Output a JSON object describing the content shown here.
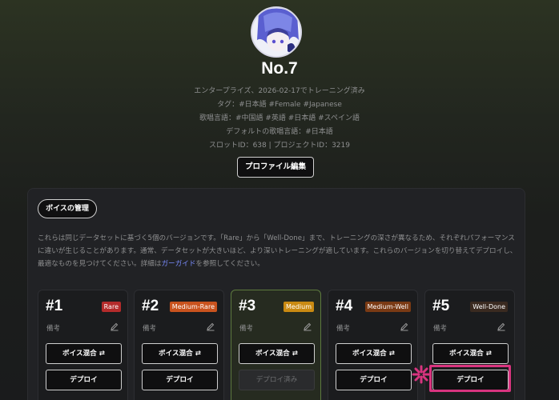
{
  "profile": {
    "name": "No.7",
    "trained_line": "エンタープライズ、2026-02-17でトレーニング済み",
    "tags_line": "タグ：#日本語 #Female #Japanese",
    "singing_langs_line": "歌唱言語：#中国語 #英語 #日本語 #スペイン語",
    "default_lang_line": "デフォルトの歌唱言語：#日本語",
    "ids_line": "スロットID：638 | プロジェクトID：3219",
    "edit_button": "プロファイル編集"
  },
  "voice_panel": {
    "title": "ボイスの管理",
    "description_before_link": "これらは同じデータセットに基づく5個のバージョンです。「Rare」から「Well-Done」まで、トレーニングの深さが異なるため、それぞれパフォーマンスに違いが生じることがあります。通常、データセットが大きいほど、より深いトレーニングが適しています。これらのバージョンを切り替えてデプロイし、最適なものを見つけてください。詳細は",
    "link_text": "ガーガイド",
    "description_after_link": "を参照してください。"
  },
  "versions": [
    {
      "num": "#1",
      "badge": "Rare",
      "badge_color": "#b42b2b",
      "note": "備考",
      "mix_label": "ボイス混合 ⇄",
      "deploy_label": "デプロイ",
      "deployed": false
    },
    {
      "num": "#2",
      "badge": "Medium-Rare",
      "badge_color": "#c9531e",
      "note": "備考",
      "mix_label": "ボイス混合 ⇄",
      "deploy_label": "デプロイ",
      "deployed": false
    },
    {
      "num": "#3",
      "badge": "Medium",
      "badge_color": "#c98a12",
      "note": "備考",
      "mix_label": "ボイス混合 ⇄",
      "deploy_label": "デプロイ済み",
      "deployed": true
    },
    {
      "num": "#4",
      "badge": "Medium-Well",
      "badge_color": "#7a3a14",
      "note": "備考",
      "mix_label": "ボイス混合 ⇄",
      "deploy_label": "デプロイ",
      "deployed": false
    },
    {
      "num": "#5",
      "badge": "Well-Done",
      "badge_color": "#3a2a20",
      "note": "備考",
      "mix_label": "ボイス混合 ⇄",
      "deploy_label": "デプロイ",
      "deployed": false
    }
  ],
  "colors": {
    "highlight": "#d8347f",
    "link": "#7a8cff",
    "active_card_border": "#5d7a3e"
  }
}
